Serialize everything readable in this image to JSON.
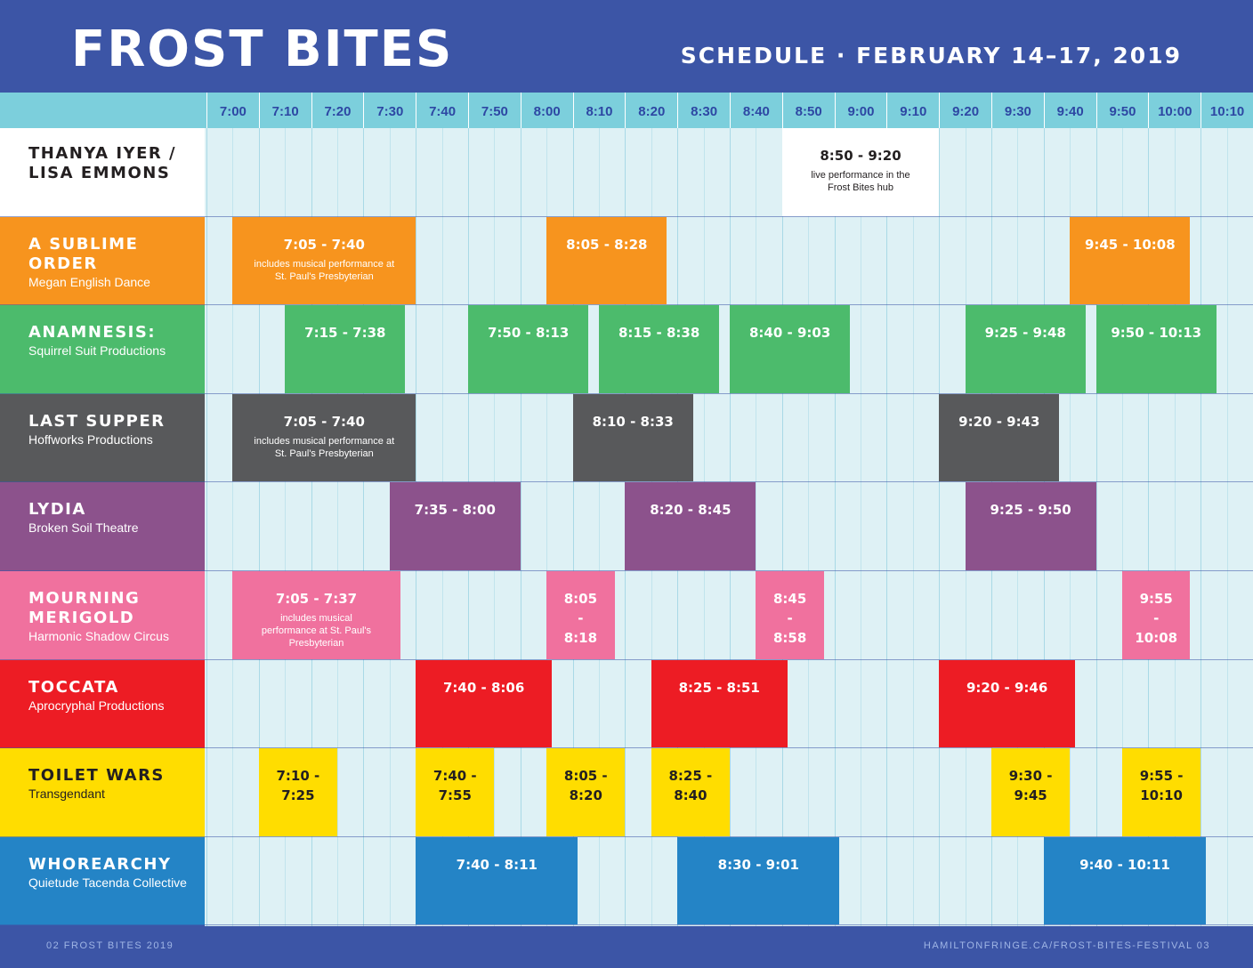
{
  "header": {
    "title": "FROST BITES",
    "subtitle": "SCHEDULE · FEBRUARY 14–17, 2019"
  },
  "times": [
    "7:00",
    "7:10",
    "7:20",
    "7:30",
    "7:40",
    "7:50",
    "8:00",
    "8:10",
    "8:20",
    "8:30",
    "8:40",
    "8:50",
    "9:00",
    "9:10",
    "9:20",
    "9:30",
    "9:40",
    "9:50",
    "10:00",
    "10:10"
  ],
  "shows": [
    {
      "name": "THANYA IYER / LISA EMMONS",
      "company": "",
      "color": "#ffffff",
      "text_color": "#231f20",
      "slots": [
        {
          "start": "8:50",
          "end": "9:20",
          "label": "8:50 - 9:20",
          "note": "live performance in the Frost Bites hub",
          "full_row": true
        }
      ]
    },
    {
      "name": "A SUBLIME ORDER",
      "company": "Megan English Dance",
      "color": "#f7941e",
      "text_color": "#ffffff",
      "slots": [
        {
          "start": "7:05",
          "end": "7:40",
          "label": "7:05 - 7:40",
          "note": "includes musical performance at St. Paul's Presbyterian"
        },
        {
          "start": "8:05",
          "end": "8:28",
          "label": "8:05 - 8:28",
          "note": ""
        },
        {
          "start": "9:45",
          "end": "10:08",
          "label": "9:45 - 10:08",
          "note": ""
        }
      ]
    },
    {
      "name": "ANAMNESIS:",
      "company": "Squirrel Suit Productions",
      "color": "#4cbb6c",
      "text_color": "#ffffff",
      "slots": [
        {
          "start": "7:15",
          "end": "7:38",
          "label": "7:15 - 7:38",
          "note": ""
        },
        {
          "start": "7:50",
          "end": "8:13",
          "label": "7:50 - 8:13",
          "note": ""
        },
        {
          "start": "8:15",
          "end": "8:38",
          "label": "8:15 - 8:38",
          "note": ""
        },
        {
          "start": "8:40",
          "end": "9:03",
          "label": "8:40 - 9:03",
          "note": ""
        },
        {
          "start": "9:25",
          "end": "9:48",
          "label": "9:25 - 9:48",
          "note": ""
        },
        {
          "start": "9:50",
          "end": "10:13",
          "label": "9:50 - 10:13",
          "note": ""
        }
      ]
    },
    {
      "name": "LAST SUPPER",
      "company": "Hoffworks Productions",
      "color": "#58595b",
      "text_color": "#ffffff",
      "slots": [
        {
          "start": "7:05",
          "end": "7:40",
          "label": "7:05 - 7:40",
          "note": "includes musical performance at St. Paul's Presbyterian"
        },
        {
          "start": "8:10",
          "end": "8:33",
          "label": "8:10 - 8:33",
          "note": ""
        },
        {
          "start": "9:20",
          "end": "9:43",
          "label": "9:20 - 9:43",
          "note": ""
        }
      ]
    },
    {
      "name": "LYDIA",
      "company": "Broken Soil Theatre",
      "color": "#8c528c",
      "text_color": "#ffffff",
      "slots": [
        {
          "start": "7:35",
          "end": "8:00",
          "label": "7:35 - 8:00",
          "note": ""
        },
        {
          "start": "8:20",
          "end": "8:45",
          "label": "8:20 - 8:45",
          "note": ""
        },
        {
          "start": "9:25",
          "end": "9:50",
          "label": "9:25 - 9:50",
          "note": ""
        }
      ]
    },
    {
      "name": "MOURNING MERIGOLD",
      "company": "Harmonic Shadow Circus",
      "color": "#f0719e",
      "text_color": "#ffffff",
      "slots": [
        {
          "start": "7:05",
          "end": "7:37",
          "label": "7:05 - 7:37",
          "note": "includes musical performance at St. Paul's Presbyterian"
        },
        {
          "start": "8:05",
          "end": "8:18",
          "label": "8:05 - 8:18",
          "note": ""
        },
        {
          "start": "8:45",
          "end": "8:58",
          "label": "8:45 - 8:58",
          "note": ""
        },
        {
          "start": "9:55",
          "end": "10:08",
          "label": "9:55 - 10:08",
          "note": ""
        }
      ]
    },
    {
      "name": "TOCCATA",
      "company": "Aprocryphal Productions",
      "color": "#ed1c24",
      "text_color": "#ffffff",
      "slots": [
        {
          "start": "7:40",
          "end": "8:06",
          "label": "7:40 - 8:06",
          "note": ""
        },
        {
          "start": "8:25",
          "end": "8:51",
          "label": "8:25 - 8:51",
          "note": ""
        },
        {
          "start": "9:20",
          "end": "9:46",
          "label": "9:20 - 9:46",
          "note": ""
        }
      ]
    },
    {
      "name": "TOILET WARS",
      "company": "Transgendant",
      "color": "#ffdd00",
      "text_color": "#231f20",
      "slots": [
        {
          "start": "7:10",
          "end": "7:25",
          "label": "7:10 - 7:25",
          "note": ""
        },
        {
          "start": "7:40",
          "end": "7:55",
          "label": "7:40 - 7:55",
          "note": ""
        },
        {
          "start": "8:05",
          "end": "8:20",
          "label": "8:05 - 8:20",
          "note": ""
        },
        {
          "start": "8:25",
          "end": "8:40",
          "label": "8:25 - 8:40",
          "note": ""
        },
        {
          "start": "9:30",
          "end": "9:45",
          "label": "9:30 - 9:45",
          "note": ""
        },
        {
          "start": "9:55",
          "end": "10:10",
          "label": "9:55 - 10:10",
          "note": ""
        }
      ]
    },
    {
      "name": "WHOREARCHY",
      "company": "Quietude Tacenda Collective",
      "color": "#2484c6",
      "text_color": "#ffffff",
      "slots": [
        {
          "start": "7:40",
          "end": "8:11",
          "label": "7:40 - 8:11",
          "note": ""
        },
        {
          "start": "8:30",
          "end": "9:01",
          "label": "8:30 - 9:01",
          "note": ""
        },
        {
          "start": "9:40",
          "end": "10:11",
          "label": "9:40 - 10:11",
          "note": ""
        }
      ]
    }
  ],
  "footer": {
    "left": "02    FROST BITES 2019",
    "right": "HAMILTONFRINGE.CA/FROST-BITES-FESTIVAL    03"
  }
}
